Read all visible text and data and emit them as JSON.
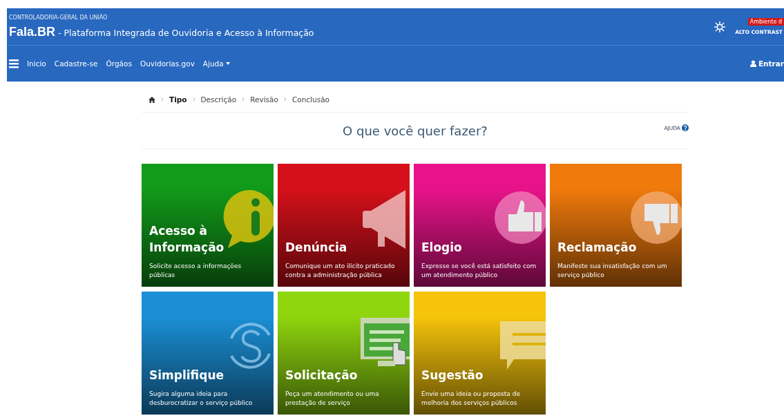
{
  "header": {
    "agency": "CONTROLADORIA-GERAL DA UNIÃO",
    "brand": "Fala.BR",
    "subtitle": "- Plataforma Integrada de Ouvidoria e Acesso à Informação",
    "env_badge": "Ambiente d",
    "contrast": "ALTO CONTRAST"
  },
  "nav": {
    "items": [
      "Inicio",
      "Cadastre-se",
      "Órgãos",
      "Ouvidorias.gov"
    ],
    "dropdown": "Ajuda",
    "login": "Entrar"
  },
  "breadcrumb": [
    {
      "label": "Tipo",
      "selected": true
    },
    {
      "label": "Descrição",
      "selected": false
    },
    {
      "label": "Revisão",
      "selected": false
    },
    {
      "label": "Conclusão",
      "selected": false
    }
  ],
  "heading": "O que você quer fazer?",
  "help": "AJUDA",
  "cards": [
    {
      "kind": "info",
      "title": "Acesso à Informação",
      "text": "Solicite acesso a informações públicas",
      "color": "#129a1a"
    },
    {
      "kind": "megaphone",
      "title": "Denúncia",
      "text": "Comunique um ato ilícito praticado contra a administração pública",
      "color": "#d5101a"
    },
    {
      "kind": "thumbs-up",
      "title": "Elogio",
      "text": "Expresse se você está satisfeito com um atendimento público",
      "color": "#e8138a"
    },
    {
      "kind": "thumbs-down",
      "title": "Reclamação",
      "text": "Manifeste sua insatisfação com um serviço público",
      "color": "#f07a0c"
    },
    {
      "kind": "simplify",
      "title": "Simplifique",
      "text": "Sugira alguma ideia para desburocratizar o serviço público",
      "color": "#1b8fd6"
    },
    {
      "kind": "screen",
      "title": "Solicitação",
      "text": "Peça um atendimento ou uma prestação de serviço",
      "color": "#8fd60e"
    },
    {
      "kind": "speech",
      "title": "Sugestão",
      "text": "Envie uma ideia ou proposta de melhoria dos serviços públicos",
      "color": "#f6c40a"
    }
  ]
}
